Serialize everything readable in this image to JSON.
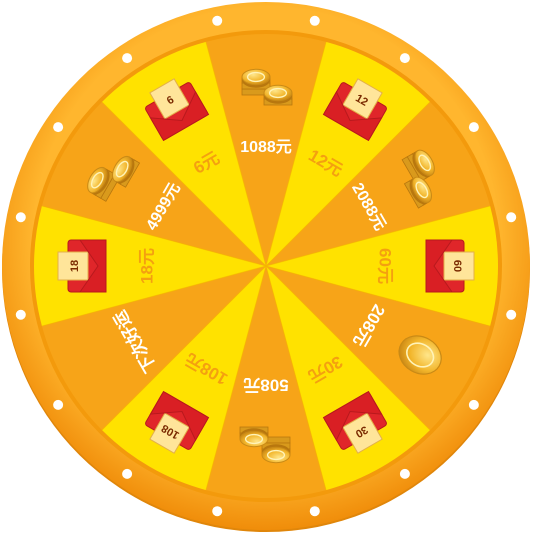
{
  "wheel": {
    "colors": {
      "rim_outer": "#f7a41c",
      "rim_inner": "#f39a0c",
      "rim_dark": "#e0860a",
      "light_segment": "#ffe200",
      "dark_segment": "#f7a418",
      "label_on_dark": "#ffffff",
      "label_on_light": "#f4a010",
      "envelope_red": "#e0262a",
      "envelope_card": "#ffe59a",
      "coin": "#f2b92b",
      "dot": "#ffffff"
    },
    "segments": [
      {
        "label": "1088元",
        "prize_icon": "coin-stack-icon",
        "shade": "dark"
      },
      {
        "label": "12元",
        "prize_icon": "red-envelope-icon",
        "badge": "12",
        "shade": "light"
      },
      {
        "label": "2088元",
        "prize_icon": "coin-stack-icon",
        "shade": "dark"
      },
      {
        "label": "60元",
        "prize_icon": "red-envelope-icon",
        "badge": "60",
        "shade": "light"
      },
      {
        "label": "208元",
        "prize_icon": "coin-icon",
        "shade": "dark"
      },
      {
        "label": "30元",
        "prize_icon": "red-envelope-icon",
        "badge": "30",
        "shade": "light"
      },
      {
        "label": "508元",
        "prize_icon": "coin-stack-icon",
        "shade": "dark"
      },
      {
        "label": "108元",
        "prize_icon": "red-envelope-icon",
        "badge": "108",
        "shade": "light"
      },
      {
        "label": "下次好运",
        "prize_icon": "none",
        "shade": "dark"
      },
      {
        "label": "18元",
        "prize_icon": "red-envelope-icon",
        "badge": "18",
        "shade": "light"
      },
      {
        "label": "4999元",
        "prize_icon": "coin-stack-icon",
        "shade": "dark"
      },
      {
        "label": "6元",
        "prize_icon": "red-envelope-icon",
        "badge": "6",
        "shade": "light"
      }
    ]
  }
}
